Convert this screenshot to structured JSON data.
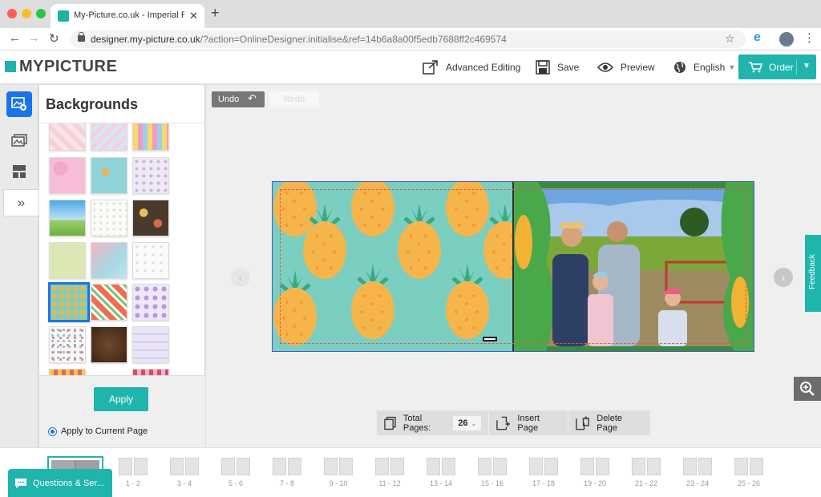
{
  "browser": {
    "tab_title": "My-Picture.co.uk - Imperial Photo",
    "tab_close": "✕",
    "new_tab": "+",
    "url_domain": "designer.my-picture.co.uk",
    "url_path": "/?action=OnlineDesigner.initialise&ref=14b6a8a00f5edb7688ff2c469574"
  },
  "header": {
    "logo": "MYPICTURE",
    "advanced_editing": "Advanced Editing",
    "save": "Save",
    "preview": "Preview",
    "language": "English",
    "order": "Order"
  },
  "panel": {
    "title": "Backgrounds",
    "apply": "Apply",
    "apply_scope": "Apply to Current Page"
  },
  "workspace": {
    "undo": "Undo",
    "redo": "Redo",
    "feedback": "Feedback"
  },
  "page_toolbar": {
    "total_label": "Total Pages:",
    "total_value": "26",
    "insert": "Insert Page",
    "delete": "Delete Page"
  },
  "page_strip": {
    "pages": [
      "1 - 2",
      "3 - 4",
      "5 - 6",
      "7 - 8",
      "9 - 10",
      "11 - 12",
      "13 - 14",
      "15 - 16",
      "17 - 18",
      "19 - 20",
      "21 - 22",
      "23 - 24",
      "25 - 26"
    ]
  },
  "support": {
    "label": "Questions & Ser..."
  },
  "colors": {
    "brand": "#1fb5ad",
    "selection": "#1a73e8",
    "bleed_line": "#e0556b"
  }
}
